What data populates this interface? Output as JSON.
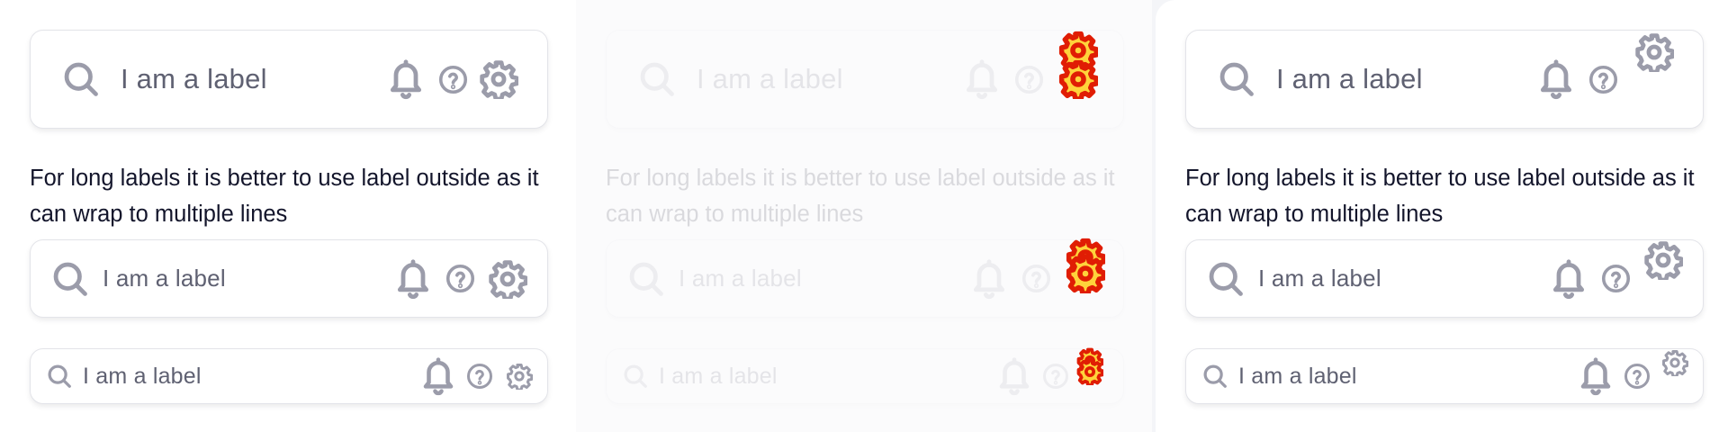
{
  "panels": [
    {
      "fields": {
        "large": {
          "label": "I am a label",
          "icons": [
            "search-icon",
            "bell-icon",
            "help-icon",
            "gear-icon"
          ]
        },
        "medium": {
          "label": "I am a label",
          "icons": [
            "search-icon",
            "bell-icon",
            "help-icon",
            "gear-icon"
          ]
        },
        "small": {
          "label": "I am a label",
          "icons": [
            "search-icon",
            "bell-icon",
            "help-icon",
            "gear-icon"
          ]
        }
      },
      "outside_label": "For long labels it is better to use label outside as it can wrap to multiple lines"
    },
    {
      "fields": {
        "large": {
          "label": "I am a label"
        },
        "medium": {
          "label": "I am a label"
        },
        "small": {
          "label": "I am a label"
        }
      },
      "outside_label": "For long labels it is better to use label outside as it can wrap to multiple lines",
      "state": "disabled"
    },
    {
      "fields": {
        "large": {
          "label": "I am a label"
        },
        "medium": {
          "label": "I am a label"
        },
        "small": {
          "label": "I am a label"
        }
      },
      "outside_label": "For long labels it is better to use label outside as it can wrap to multiple lines"
    }
  ],
  "colors": {
    "icon": "#9b9caa",
    "label": "#5f6172",
    "outside_label": "#13152b",
    "highlight_fill": "#ffd33b",
    "highlight_stroke": "#e01d04"
  }
}
